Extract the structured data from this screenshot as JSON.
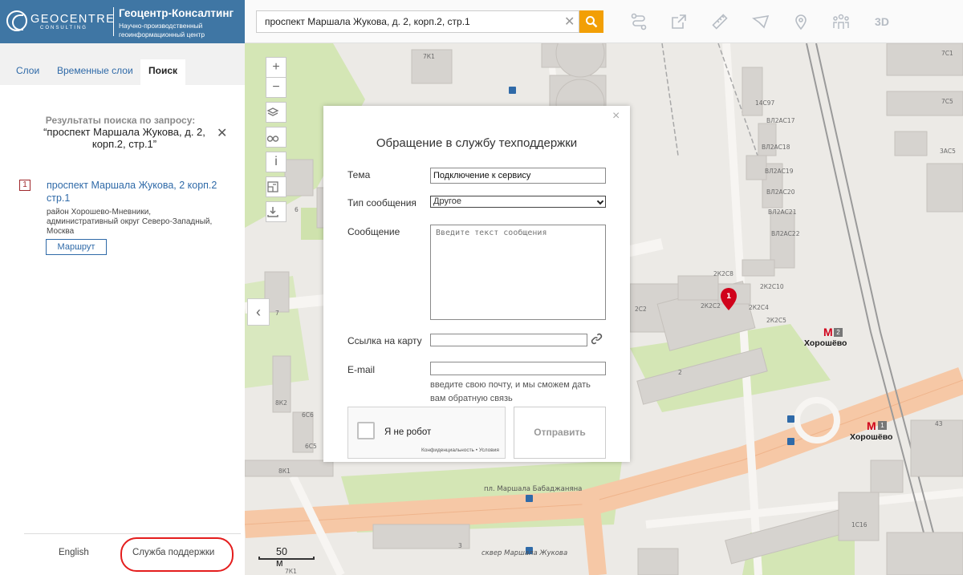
{
  "header": {
    "logo_word": "GEOCENTRE",
    "logo_sub": "CONSULTING",
    "company_name": "Геоцентр-Консалтинг",
    "company_desc": "Научно-производственный геоинформационный центр"
  },
  "search": {
    "value": "проспект Маршала Жукова, д. 2, корп.2, стр.1",
    "clear": "✕"
  },
  "toolbar": {
    "tools": [
      "route-icon",
      "share-icon",
      "ruler-icon",
      "area-icon",
      "marker-icon",
      "people-icon"
    ],
    "label_3d": "3D"
  },
  "tabs": [
    {
      "label": "Слои",
      "active": false
    },
    {
      "label": "Временные слои",
      "active": false
    },
    {
      "label": "Поиск",
      "active": true
    }
  ],
  "results": {
    "caption": "Результаты поиска по запросу:",
    "query": "“проспект Маршала Жукова, д. 2, корп.2, стр.1”",
    "close": "✕",
    "items": [
      {
        "number": "1",
        "title": "проспект Маршала Жукова, 2 корп.2 стр.1",
        "address": "район Хорошево-Мневники, административный округ Северо-Западный, Москва",
        "route_label": "Маршрут"
      }
    ]
  },
  "footer": {
    "language": "English",
    "support": "Служба поддержки",
    "highlight_color": "#e41d1d"
  },
  "map_controls": {
    "zoom_in": "+",
    "zoom_out": "−",
    "info": "i",
    "collapse": "‹",
    "scale": "50 м"
  },
  "map": {
    "labels": [
      "7К1",
      "14С97",
      "ВЛ2АС17",
      "ВЛ2АС18",
      "ВЛ2АС19",
      "ВЛ2АС20",
      "ВЛ2АС21",
      "ВЛ2АС22",
      "2К2С8",
      "2К2С10",
      "2К2С2",
      "2К2С4",
      "2К2С5",
      "2С2",
      "2",
      "8К2",
      "6С6",
      "6С5",
      "8К1",
      "7",
      "6",
      "7С1",
      "7С5",
      "3АС5",
      "43",
      "1С16",
      "3",
      "7К1"
    ],
    "street": "пл. Маршала Бабаджаняна",
    "square": "сквер Маршала Жукова",
    "marker": "1",
    "metro": [
      {
        "name": "Хорошёво",
        "line": "2"
      },
      {
        "name": "Хорошёво",
        "line": "1"
      }
    ],
    "metro_symbol": "М",
    "colors": {
      "road": "#f6c8a6",
      "green": "#d4e6b5",
      "building": "#d6d3cf",
      "marker": "#d0021b"
    }
  },
  "dialog": {
    "title": "Обращение в службу техподдержки",
    "close": "×",
    "fields": {
      "subject_label": "Тема",
      "subject_value": "Подключение к сервису",
      "type_label": "Тип сообщения",
      "type_value": "Другое",
      "message_label": "Сообщение",
      "message_placeholder": "Введите текст сообщения",
      "link_label": "Ссылка на карту",
      "link_value": "",
      "email_label": "E-mail",
      "email_value": "",
      "email_hint": "введите свою почту, и мы сможем дать вам обратную связь"
    },
    "captcha": {
      "label": "Я не робот",
      "terms": "Конфиденциальность • Условия"
    },
    "submit": "Отправить"
  }
}
